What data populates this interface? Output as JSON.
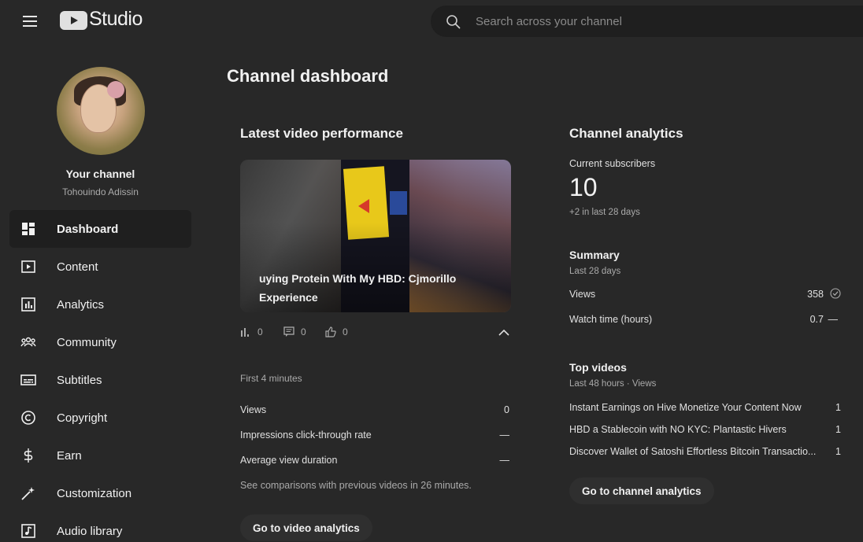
{
  "header": {
    "logo_text": "Studio",
    "search_placeholder": "Search across your channel"
  },
  "sidebar": {
    "channel_label": "Your channel",
    "channel_name": "Tohouindo Adissin",
    "items": [
      {
        "label": "Dashboard",
        "icon": "dashboard-icon",
        "active": true
      },
      {
        "label": "Content",
        "icon": "content-icon"
      },
      {
        "label": "Analytics",
        "icon": "analytics-icon"
      },
      {
        "label": "Community",
        "icon": "community-icon"
      },
      {
        "label": "Subtitles",
        "icon": "subtitles-icon"
      },
      {
        "label": "Copyright",
        "icon": "copyright-icon"
      },
      {
        "label": "Earn",
        "icon": "earn-icon"
      },
      {
        "label": "Customization",
        "icon": "customization-icon"
      },
      {
        "label": "Audio library",
        "icon": "audio-library-icon"
      }
    ]
  },
  "main": {
    "page_title": "Channel dashboard"
  },
  "latest_video": {
    "title": "Latest video performance",
    "video_title": "uying Protein With My HBD: Cjmorillo Experience",
    "views": "0",
    "comments": "0",
    "likes": "0",
    "period_label": "First 4 minutes",
    "metrics": [
      {
        "label": "Views",
        "value": "0"
      },
      {
        "label": "Impressions click-through rate",
        "value": "—"
      },
      {
        "label": "Average view duration",
        "value": "—"
      }
    ],
    "comparison_note": "See comparisons with previous videos in 26 minutes.",
    "button_label": "Go to video analytics"
  },
  "channel_analytics": {
    "title": "Channel analytics",
    "subscribers_label": "Current subscribers",
    "subscribers_count": "10",
    "subscribers_change": "+2 in last 28 days",
    "summary_title": "Summary",
    "summary_period": "Last 28 days",
    "summary_rows": [
      {
        "label": "Views",
        "value": "358"
      },
      {
        "label": "Watch time (hours)",
        "value": "0.7",
        "trend": "—"
      }
    ],
    "top_videos_title": "Top videos",
    "top_videos_period": "Last 48 hours · Views",
    "top_videos": [
      {
        "title": "Instant Earnings on Hive Monetize Your Content Now",
        "views": "1"
      },
      {
        "title": "HBD a Stablecoin with NO KYC: Plantastic Hivers",
        "views": "1"
      },
      {
        "title": "Discover Wallet of Satoshi Effortless Bitcoin Transactio...",
        "views": "1"
      }
    ],
    "button_label": "Go to channel analytics"
  },
  "colors": {
    "background": "#282828",
    "surface": "#1f1f1f",
    "text": "#f1f1f1",
    "muted": "#aaaaaa"
  }
}
